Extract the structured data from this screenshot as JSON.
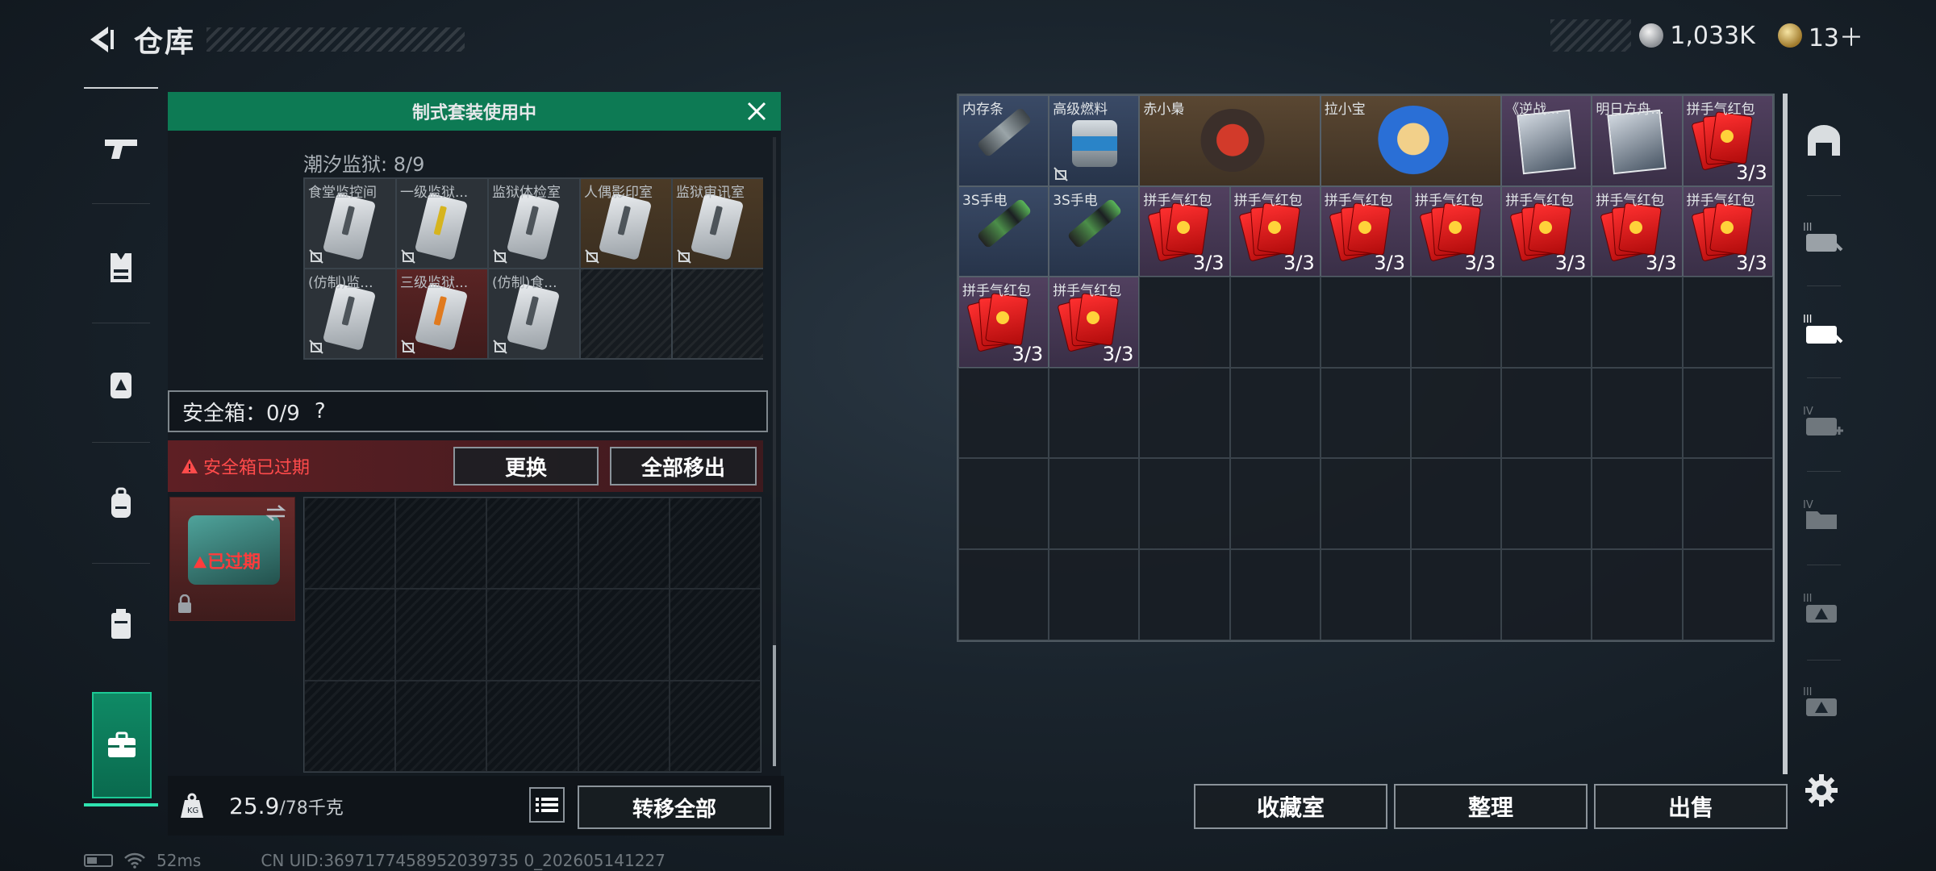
{
  "header": {
    "title": "仓库"
  },
  "currency": [
    {
      "icon": "silver-coin-icon",
      "value": "1,033K"
    },
    {
      "icon": "gold-coin-icon",
      "value": "13＋"
    }
  ],
  "leftnav": {
    "items": [
      {
        "icon": "gun-icon"
      },
      {
        "icon": "armor-vest-icon"
      },
      {
        "icon": "backpack-armor-icon"
      },
      {
        "icon": "backpack-icon"
      },
      {
        "icon": "battery-pack-icon"
      },
      {
        "icon": "briefcase-icon",
        "active": true
      }
    ]
  },
  "left_panel": {
    "banner": "制式套装使用中",
    "set": {
      "label": "潮汐监狱: 8/9"
    },
    "set_items": [
      {
        "name": "食堂监控间",
        "tint": "grey",
        "bar": "grey"
      },
      {
        "name": "一级监狱...",
        "tint": "grey",
        "bar": "yellow"
      },
      {
        "name": "监狱体检室",
        "tint": "grey",
        "bar": "grey"
      },
      {
        "name": "人偶影印室",
        "tint": "orange",
        "bar": "grey"
      },
      {
        "name": "监狱审讯室",
        "tint": "orange",
        "bar": "grey"
      },
      {
        "name": "(仿制)监...",
        "tint": "grey",
        "bar": "grey"
      },
      {
        "name": "三级监狱...",
        "tint": "red",
        "bar": "orange"
      },
      {
        "name": "(仿制)食...",
        "tint": "grey",
        "bar": "grey"
      },
      {
        "name": "",
        "tint": "empty"
      },
      {
        "name": "",
        "tint": "empty"
      }
    ],
    "safe_box": {
      "label": "安全箱：0/9",
      "help": "?"
    },
    "alert": "安全箱已过期",
    "replace_button": "更换",
    "move_all_out_button": "全部移出",
    "case_status": "已过期",
    "weight": {
      "current": "25.9",
      "max": "/78千克"
    },
    "transfer_all_button": "转移全部"
  },
  "right_panel": {
    "items": [
      {
        "name": "内存条",
        "kind": "stick",
        "bg": "blue",
        "count": ""
      },
      {
        "name": "高级燃料",
        "kind": "can",
        "bg": "blue",
        "count": ""
      },
      {
        "name": "赤小梟",
        "kind": "figure-red",
        "bg": "brown",
        "count": ""
      },
      {
        "name": "拉小宝",
        "kind": "figure-blue",
        "bg": "brown",
        "count": ""
      },
      {
        "name": "《逆战...",
        "kind": "photo",
        "bg": "purple",
        "count": ""
      },
      {
        "name": "明日方舟...",
        "kind": "photo",
        "bg": "purple",
        "count": ""
      },
      {
        "name": "拼手气红包",
        "kind": "red",
        "bg": "purple",
        "count": "3/3"
      },
      {
        "name": "3S手电",
        "kind": "stick-green",
        "bg": "blue",
        "count": ""
      },
      {
        "name": "3S手电",
        "kind": "stick-green",
        "bg": "blue",
        "count": ""
      },
      {
        "name": "拼手气红包",
        "kind": "red",
        "bg": "purple",
        "count": "3/3"
      },
      {
        "name": "拼手气红包",
        "kind": "red",
        "bg": "purple",
        "count": "3/3"
      },
      {
        "name": "拼手气红包",
        "kind": "red",
        "bg": "purple",
        "count": "3/3"
      },
      {
        "name": "拼手气红包",
        "kind": "red",
        "bg": "purple",
        "count": "3/3"
      },
      {
        "name": "拼手气红包",
        "kind": "red",
        "bg": "purple",
        "count": "3/3"
      },
      {
        "name": "拼手气红包",
        "kind": "red",
        "bg": "purple",
        "count": "3/3"
      },
      {
        "name": "拼手气红包",
        "kind": "red",
        "bg": "purple",
        "count": "3/3"
      },
      {
        "name": "拼手气红包",
        "kind": "red",
        "bg": "purple",
        "count": "3/3"
      },
      {
        "name": "拼手气红包",
        "kind": "red",
        "bg": "purple",
        "count": "3/3"
      }
    ],
    "collection_button": "收藏室",
    "sort_button": "整理",
    "sell_button": "出售"
  },
  "rightnav": {
    "items": [
      {
        "icon": "bunker-icon"
      },
      {
        "icon": "storage-iii-edit-icon"
      },
      {
        "icon": "storage-iii-active-icon"
      },
      {
        "icon": "storage-iv-add-icon"
      },
      {
        "icon": "storage-iv-folder-icon"
      },
      {
        "icon": "storage-iii-warning-icon"
      },
      {
        "icon": "storage-iii-warning-icon"
      }
    ],
    "settings_icon": "gear-icon"
  },
  "status": {
    "ping": "52ms",
    "uid": "CN UID:3697177458952039735 0_202605141227"
  },
  "colors": {
    "accent": "#0d7a54",
    "alert": "#ff4b4b",
    "active_tab": "#1cc995"
  }
}
